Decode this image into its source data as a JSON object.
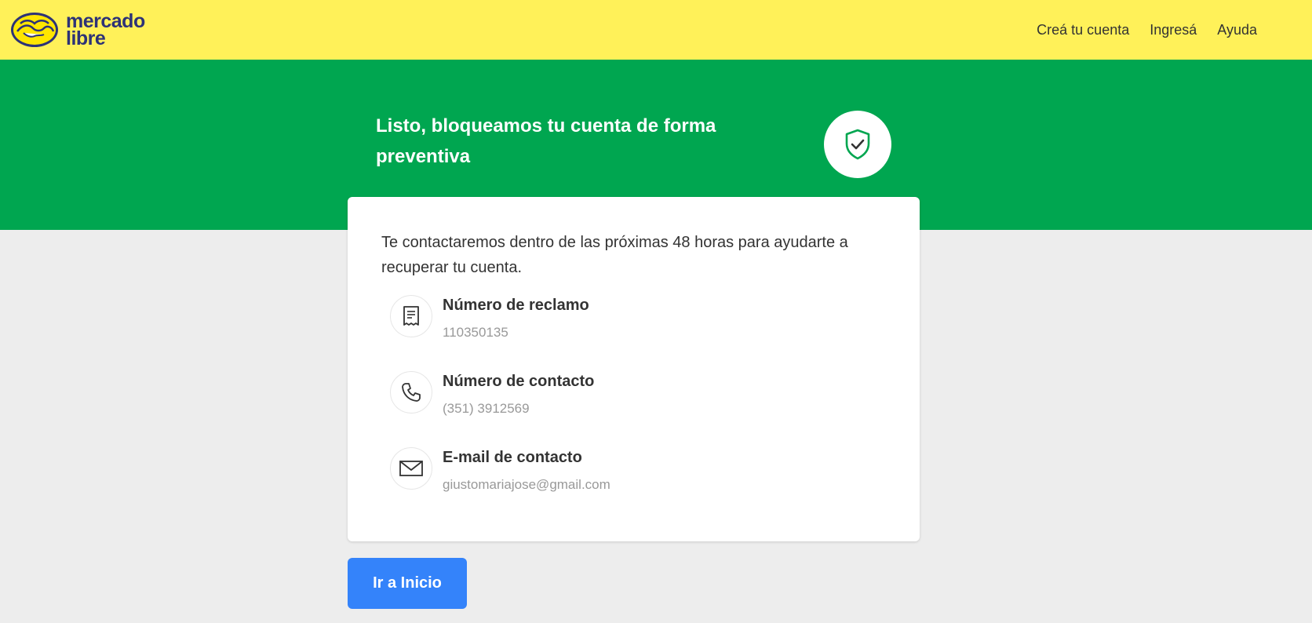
{
  "header": {
    "logo_line1": "mercado",
    "logo_line2": "libre",
    "nav": {
      "create_account": "Creá tu cuenta",
      "login": "Ingresá",
      "help": "Ayuda"
    }
  },
  "banner": {
    "title": "Listo, bloqueamos tu cuenta de forma preventiva",
    "icon": "shield-check-icon"
  },
  "card": {
    "intro": "Te contactaremos dentro de las próximas 48 horas para ayudarte a recuperar tu cuenta.",
    "items": [
      {
        "icon": "receipt-icon",
        "title": "Número de reclamo",
        "value": "110350135"
      },
      {
        "icon": "phone-icon",
        "title": "Número de contacto",
        "value": "(351) 3912569"
      },
      {
        "icon": "mail-icon",
        "title": "E-mail de contacto",
        "value": "giustomariajose@gmail.com"
      }
    ]
  },
  "actions": {
    "home_button": "Ir a Inicio"
  },
  "colors": {
    "header_bg": "#fff159",
    "banner_bg": "#00a650",
    "page_bg": "#ededed",
    "primary_button": "#3483fa",
    "logo_text": "#2d3277"
  }
}
